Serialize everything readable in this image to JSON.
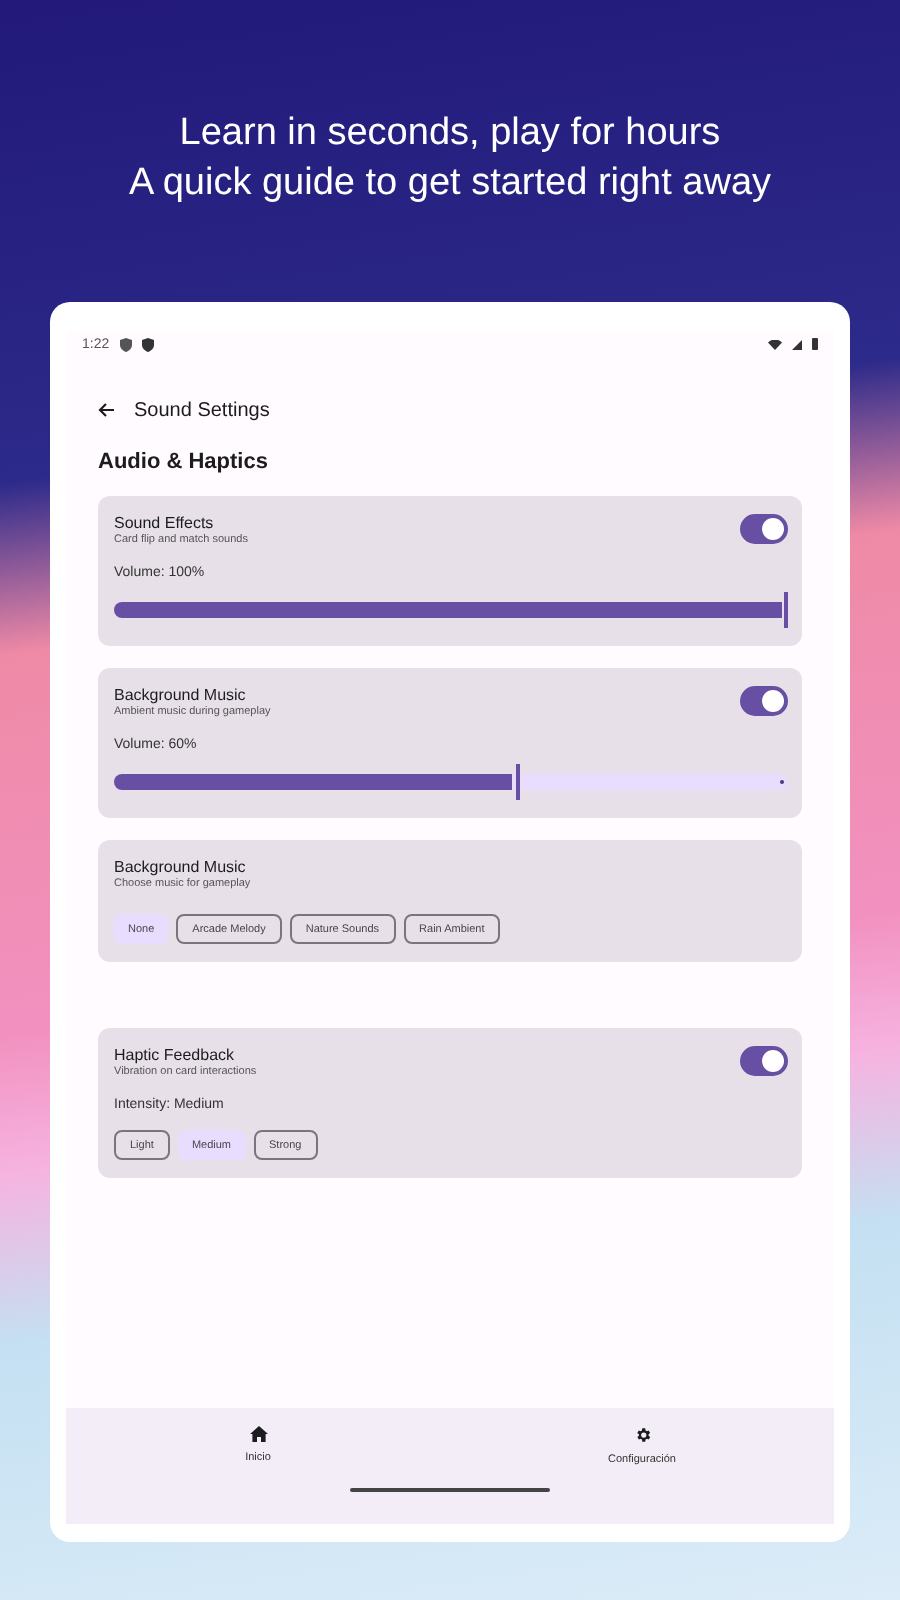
{
  "headline": [
    "Learn in seconds, play for hours",
    "A quick guide to get started right away"
  ],
  "status_bar": {
    "time": "1:22"
  },
  "toolbar": {
    "title": "Sound Settings"
  },
  "section_title": "Audio & Haptics",
  "cards": [
    {
      "kind": "slider",
      "title": "Sound Effects",
      "subtitle": "Card flip and match sounds",
      "on": true,
      "reading": "Volume: 100%",
      "level": 1.0
    },
    {
      "kind": "slider",
      "title": "Background Music",
      "subtitle": "Ambient music during gameplay",
      "on": true,
      "reading": "Volume: 60%",
      "level": 0.6
    },
    {
      "kind": "chips",
      "title": "Background Music",
      "subtitle": "Choose music for gameplay",
      "chips": [
        {
          "label": "None",
          "selected": true
        },
        {
          "label": "Arcade Melody",
          "selected": false
        },
        {
          "label": "Nature Sounds",
          "selected": false
        },
        {
          "label": "Rain Ambient",
          "selected": false
        }
      ]
    },
    {
      "kind": "toggle_chips",
      "title": "Haptic Feedback",
      "subtitle": "Vibration on card interactions",
      "on": true,
      "reading": "Intensity: Medium",
      "chips": [
        {
          "label": "Light",
          "selected": false
        },
        {
          "label": "Medium",
          "selected": true
        },
        {
          "label": "Strong",
          "selected": false
        }
      ]
    }
  ],
  "nav": [
    {
      "kind": "home",
      "label": "Inicio"
    },
    {
      "kind": "settings",
      "label": "Configuración"
    }
  ]
}
